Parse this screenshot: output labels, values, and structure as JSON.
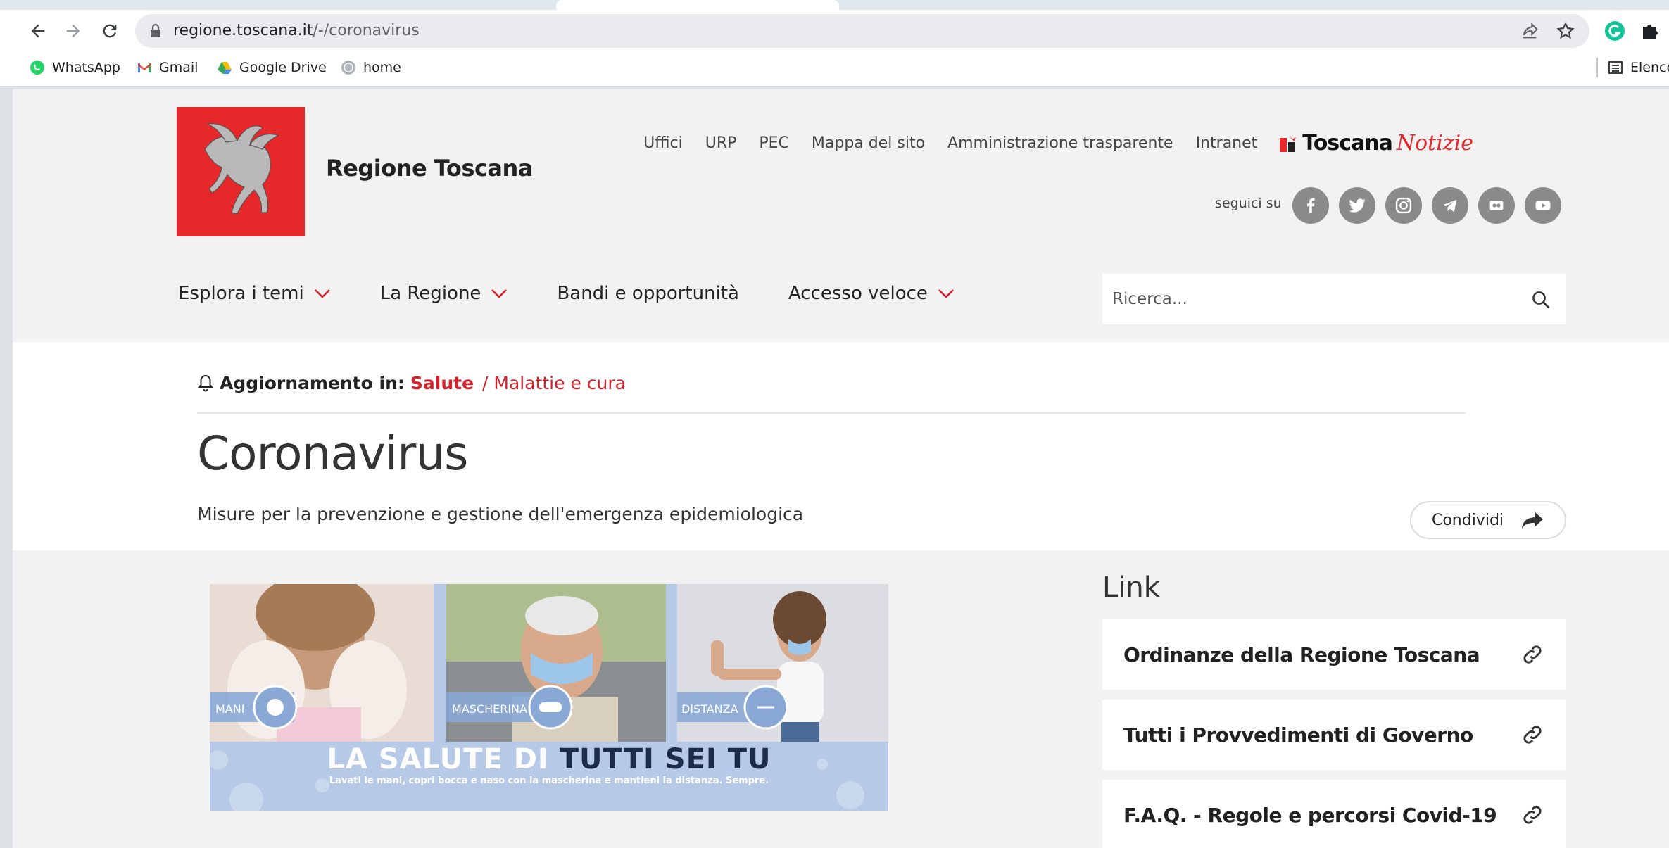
{
  "browser": {
    "url_host": "regione.toscana.it",
    "url_path": "/-/coronavirus",
    "bookmarks": [
      {
        "label": "WhatsApp",
        "icon": "whatsapp-icon"
      },
      {
        "label": "Gmail",
        "icon": "gmail-icon"
      },
      {
        "label": "Google Drive",
        "icon": "google-drive-icon"
      },
      {
        "label": "home",
        "icon": "globe-icon"
      }
    ],
    "reading_list_label": "Elenco"
  },
  "header": {
    "site_name": "Regione Toscana",
    "util_links": [
      "Uffici",
      "URP",
      "PEC",
      "Mappa del sito",
      "Amministrazione trasparente",
      "Intranet"
    ],
    "toscana_notizie_bold": "Toscana",
    "toscana_notizie_italic": "Notizie",
    "follow_label": "seguici su",
    "social": [
      "facebook-icon",
      "twitter-icon",
      "instagram-icon",
      "telegram-icon",
      "flickr-icon",
      "youtube-icon"
    ],
    "nav": [
      {
        "label": "Esplora i temi",
        "has_menu": true
      },
      {
        "label": "La Regione",
        "has_menu": true
      },
      {
        "label": "Bandi e opportunità",
        "has_menu": false
      },
      {
        "label": "Accesso veloce",
        "has_menu": true
      }
    ],
    "search_placeholder": "Ricerca..."
  },
  "hero": {
    "update_label": "Aggiornamento in:",
    "category": "Salute",
    "subcategory": "/ Malattie e cura",
    "title": "Coronavirus",
    "description": "Misure per la prevenzione e gestione dell'emergenza epidemiologica",
    "share_label": "Condividi"
  },
  "banner": {
    "labels": [
      "MANI",
      "MASCHERINA",
      "DISTANZA"
    ],
    "headline_light": "LA SALUTE DI ",
    "headline_dark": "TUTTI SEI TU",
    "tagline": "Lavati le mani, copri bocca e naso con la mascherina e mantieni la distanza. Sempre."
  },
  "links": {
    "title": "Link",
    "items": [
      "Ordinanze della Regione Toscana",
      "Tutti i Provvedimenti di Governo",
      "F.A.Q. - Regole e percorsi Covid-19"
    ]
  },
  "colors": {
    "brand_red": "#e6282b",
    "link_red": "#d3222a",
    "social_gray": "#8a8a8a",
    "banner_blue": "#b6c9e6"
  }
}
